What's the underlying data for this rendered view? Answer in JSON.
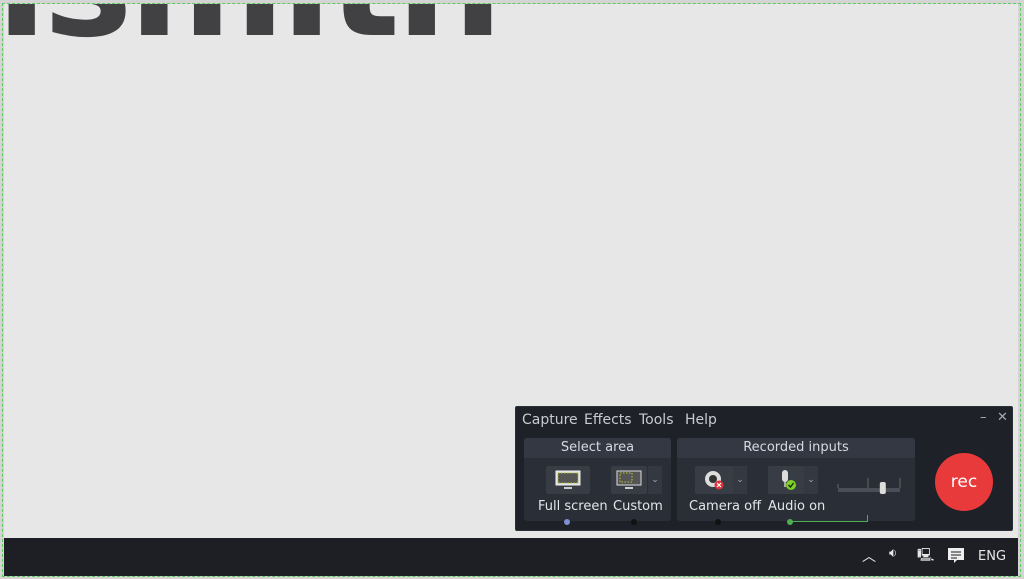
{
  "desktop": {
    "logo_text": "ismith"
  },
  "recorder": {
    "menu": [
      "Capture",
      "Effects",
      "Tools",
      "Help"
    ],
    "select_area": {
      "title": "Select area",
      "full_screen": "Full screen",
      "custom": "Custom"
    },
    "recorded_inputs": {
      "title": "Recorded inputs",
      "camera": "Camera off",
      "audio": "Audio on",
      "audio_level": 0.8
    },
    "rec_label": "rec",
    "colors": {
      "rec": "#e8393b",
      "panel": "#1e2128",
      "audio_ok": "#7ed321",
      "camera_off": "#e0323a"
    }
  },
  "taskbar": {
    "language": "ENG"
  }
}
